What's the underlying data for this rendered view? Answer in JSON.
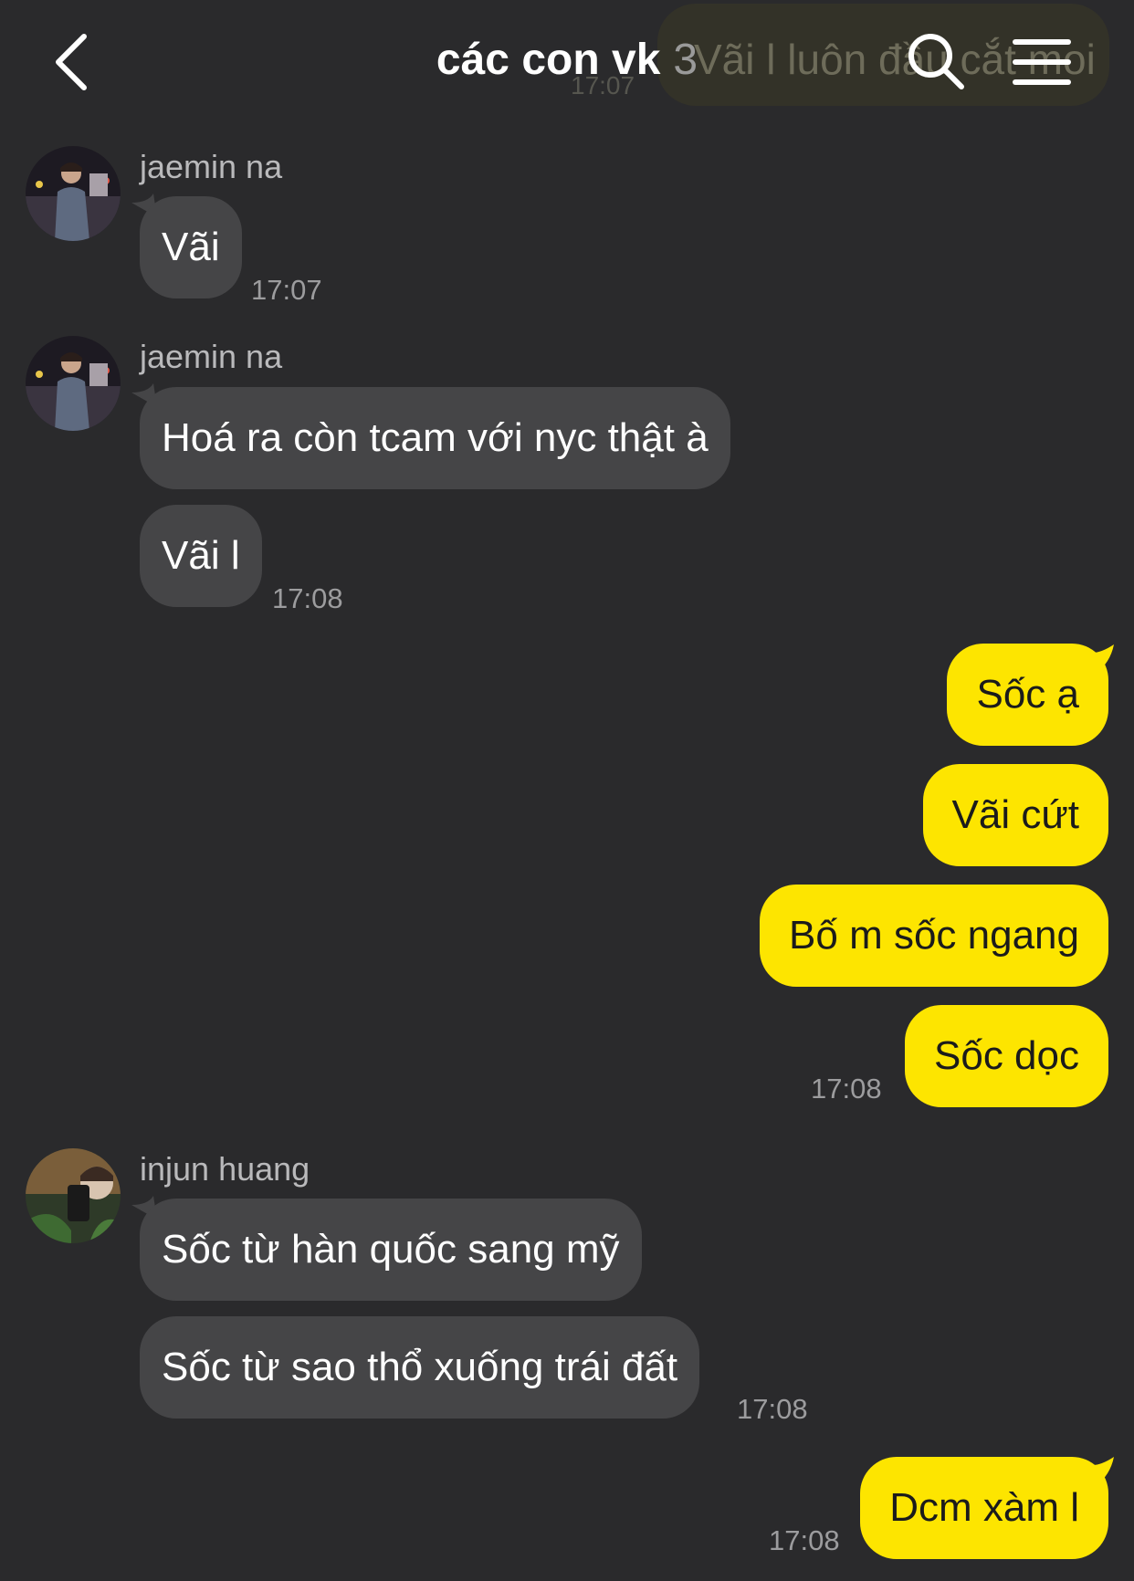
{
  "header": {
    "title": "các con vk",
    "member_count": "3",
    "icons": [
      "back-icon",
      "search-icon",
      "menu-icon"
    ]
  },
  "previous_message": {
    "text": "Vãi l luôn đầu cắt moi",
    "time": "17:07"
  },
  "messages": [
    {
      "sender": "jaemin na",
      "text": "Vãi",
      "time": "17:07"
    },
    {
      "sender": "jaemin na",
      "text": "Hoá ra còn tcam với nyc thật à"
    },
    {
      "text": "Vãi l",
      "time": "17:08"
    },
    {
      "own": true,
      "text": "Sốc ạ"
    },
    {
      "own": true,
      "text": "Vãi cứt"
    },
    {
      "own": true,
      "text": "Bố m sốc ngang"
    },
    {
      "own": true,
      "text": "Sốc dọc",
      "time": "17:08"
    },
    {
      "sender": "injun huang",
      "text": "Sốc từ hàn quốc sang mỹ"
    },
    {
      "text": "Sốc từ sao thổ xuống trái đất",
      "time": "17:08"
    },
    {
      "own": true,
      "text": "Dcm xàm l",
      "time": "17:08"
    }
  ],
  "colors": {
    "background": "#2a2a2c",
    "incoming_bubble": "#454547",
    "outgoing_bubble": "#fde500",
    "timestamp": "#9c9c9e"
  }
}
